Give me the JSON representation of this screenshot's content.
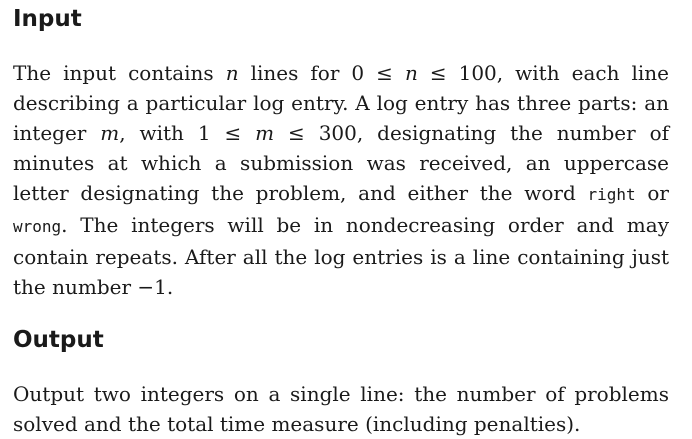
{
  "input_section": {
    "heading": "Input",
    "text": {
      "t1": "The input contains ",
      "var_n": "n",
      "t2": " lines for ",
      "m1_lo": "0",
      "m1_le1": " ≤ ",
      "m1_n": "n",
      "m1_le2": " ≤ ",
      "m1_hi": "100",
      "t3": ", with each line describing a particular log entry. A log entry has three parts: an integer ",
      "var_m": "m",
      "t4": ", with ",
      "m2_lo": "1",
      "m2_le1": " ≤ ",
      "m2_m": "m",
      "m2_le2": " ≤ ",
      "m2_hi": "300",
      "t5": ", designating the number of minutes at which a submission was received, an uppercase letter designating the problem, and either the word ",
      "code_right": "right",
      "t6": " or ",
      "code_wrong": "wrong",
      "t7": ". The integers will be in nondecreasing order and may contain repeats. After all the log entries is a line containing just the number ",
      "m3": "−1",
      "t8": "."
    }
  },
  "output_section": {
    "heading": "Output",
    "text": "Output two integers on a single line: the number of problems solved and the total time measure (including penalties)."
  }
}
